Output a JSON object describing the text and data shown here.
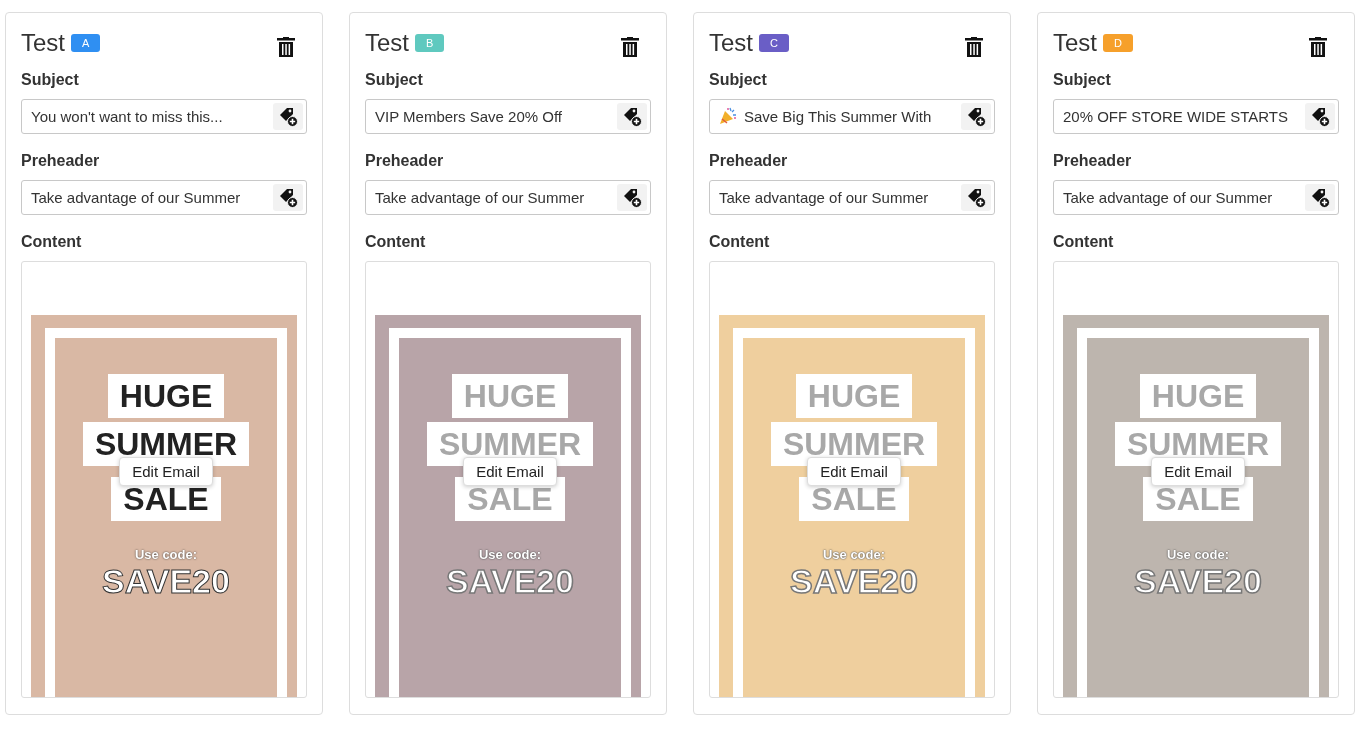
{
  "variants": [
    {
      "title": "Test",
      "badge": {
        "label": "A",
        "color": "#2f8ff2"
      },
      "subject": {
        "label": "Subject",
        "value": "You won't want to miss this...",
        "leading_icon": false
      },
      "preheader": {
        "label": "Preheader",
        "value": "Take advantage of our Summer"
      },
      "content": {
        "label": "Content",
        "headline": [
          "HUGE",
          "SUMMER",
          "SALE"
        ],
        "code_label": "Use code:",
        "code": "SAVE20",
        "dimmed": false,
        "button": "Edit Email"
      }
    },
    {
      "title": "Test",
      "badge": {
        "label": "B",
        "color": "#5fc9bf"
      },
      "subject": {
        "label": "Subject",
        "value": "VIP Members Save 20% Off",
        "leading_icon": false
      },
      "preheader": {
        "label": "Preheader",
        "value": "Take advantage of our Summer"
      },
      "content": {
        "label": "Content",
        "headline": [
          "HUGE",
          "SUMMER",
          "SALE"
        ],
        "code_label": "Use code:",
        "code": "SAVE20",
        "dimmed": true,
        "button": "Edit Email"
      }
    },
    {
      "title": "Test",
      "badge": {
        "label": "C",
        "color": "#6a5ec6"
      },
      "subject": {
        "label": "Subject",
        "value": "Save Big This Summer With",
        "leading_icon": true
      },
      "preheader": {
        "label": "Preheader",
        "value": "Take advantage of our Summer"
      },
      "content": {
        "label": "Content",
        "headline": [
          "HUGE",
          "SUMMER",
          "SALE"
        ],
        "code_label": "Use code:",
        "code": "SAVE20",
        "dimmed": true,
        "button": "Edit Email"
      }
    },
    {
      "title": "Test",
      "badge": {
        "label": "D",
        "color": "#f6a02b"
      },
      "subject": {
        "label": "Subject",
        "value": "20% OFF STORE WIDE STARTS",
        "leading_icon": false
      },
      "preheader": {
        "label": "Preheader",
        "value": "Take advantage of our Summer"
      },
      "content": {
        "label": "Content",
        "headline": [
          "HUGE",
          "SUMMER",
          "SALE"
        ],
        "code_label": "Use code:",
        "code": "SAVE20",
        "dimmed": true,
        "button": "Edit Email"
      }
    }
  ]
}
